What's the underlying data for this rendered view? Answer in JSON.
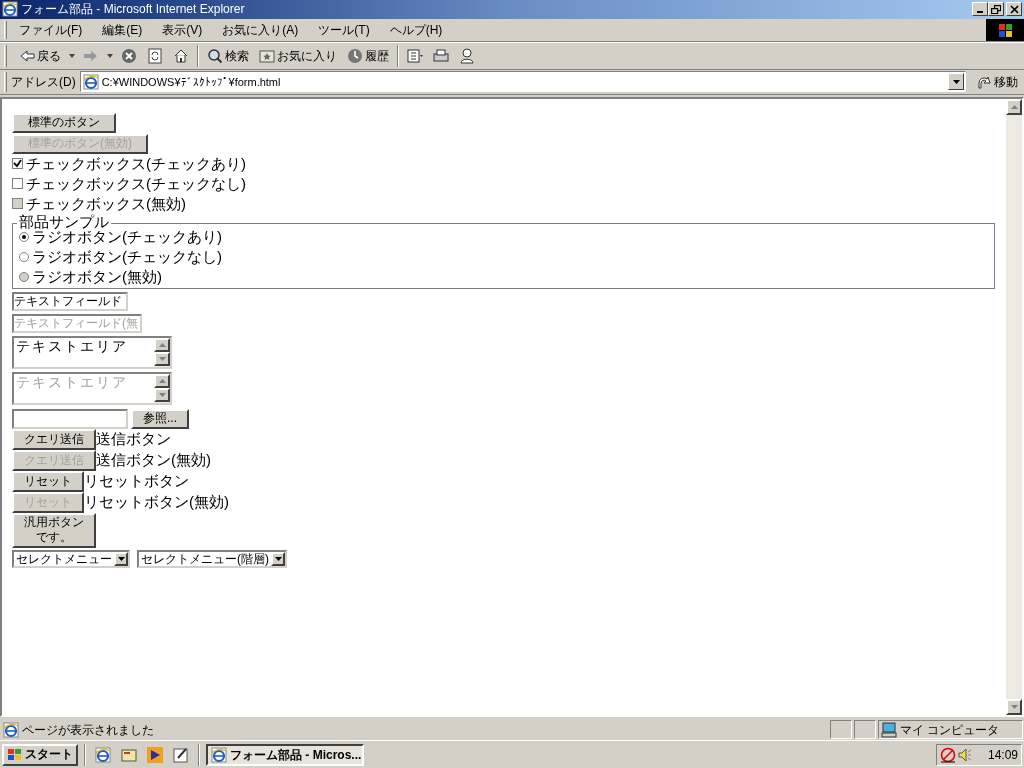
{
  "window": {
    "title": "フォーム部品 - Microsoft Internet Explorer"
  },
  "menu": [
    "ファイル(F)",
    "編集(E)",
    "表示(V)",
    "お気に入り(A)",
    "ツール(T)",
    "ヘルプ(H)"
  ],
  "toolbar": [
    {
      "kind": "back",
      "label": "戻る"
    },
    {
      "kind": "forward"
    },
    {
      "kind": "stop"
    },
    {
      "kind": "refresh"
    },
    {
      "kind": "home"
    },
    {
      "kind": "search",
      "label": "検索"
    },
    {
      "kind": "favorites",
      "label": "お気に入り"
    },
    {
      "kind": "history",
      "label": "履歴"
    },
    {
      "kind": "mail"
    },
    {
      "kind": "print"
    },
    {
      "kind": "messenger"
    }
  ],
  "address": {
    "label": "アドレス(D)",
    "value": "C:¥WINDOWS¥ﾃﾞｽｸﾄｯﾌﾟ¥form.html",
    "go": "移動"
  },
  "form": [
    {
      "kind": "button",
      "label": "標準のボタン",
      "disabled": false
    },
    {
      "kind": "button",
      "label": "標準のボタン(無効)",
      "disabled": true
    },
    {
      "kind": "checkbox",
      "label": "チェックボックス(チェックあり)",
      "checked": true,
      "disabled": false
    },
    {
      "kind": "checkbox",
      "label": "チェックボックス(チェックなし)",
      "checked": false,
      "disabled": false
    },
    {
      "kind": "checkbox",
      "label": "チェックボックス(無効)",
      "checked": false,
      "disabled": true
    },
    {
      "kind": "fieldset",
      "legend": "部品サンプル",
      "radios": [
        {
          "label": "ラジオボタン(チェックあり)",
          "checked": true,
          "disabled": false
        },
        {
          "label": "ラジオボタン(チェックなし)",
          "checked": false,
          "disabled": false
        },
        {
          "label": "ラジオボタン(無効)",
          "checked": false,
          "disabled": true
        }
      ]
    },
    {
      "kind": "text_field",
      "value": "テキストフィールド",
      "disabled": false
    },
    {
      "kind": "text_field",
      "value": "テキストフィールド(無",
      "disabled": true
    },
    {
      "kind": "textarea",
      "value": "テキストエリア",
      "disabled": false
    },
    {
      "kind": "textarea",
      "value": "テキストエリア",
      "disabled": true
    },
    {
      "kind": "file",
      "button": "参照..."
    },
    {
      "kind": "submit",
      "label": "クエリ送信",
      "caption": "送信ボタン",
      "disabled": false
    },
    {
      "kind": "submit",
      "label": "クエリ送信",
      "caption": "送信ボタン(無効)",
      "disabled": true
    },
    {
      "kind": "submit",
      "label": "リセット",
      "caption": "リセットボタン",
      "disabled": false
    },
    {
      "kind": "submit",
      "label": "リセット",
      "caption": "リセットボタン(無効)",
      "disabled": true
    },
    {
      "kind": "tall_button",
      "lines": [
        "汎用ボタン",
        "です。"
      ]
    },
    {
      "kind": "selects",
      "items": [
        "セレクトメニュー",
        "セレクトメニュー(階層)"
      ]
    }
  ],
  "status_bar": {
    "text": "ページが表示されました",
    "zone": "マイ コンピュータ"
  },
  "taskbar": {
    "start": "スタート",
    "tasks": [
      {
        "label": "フォーム部品 - Micros...",
        "selected": true
      }
    ],
    "clock": "14:09"
  }
}
